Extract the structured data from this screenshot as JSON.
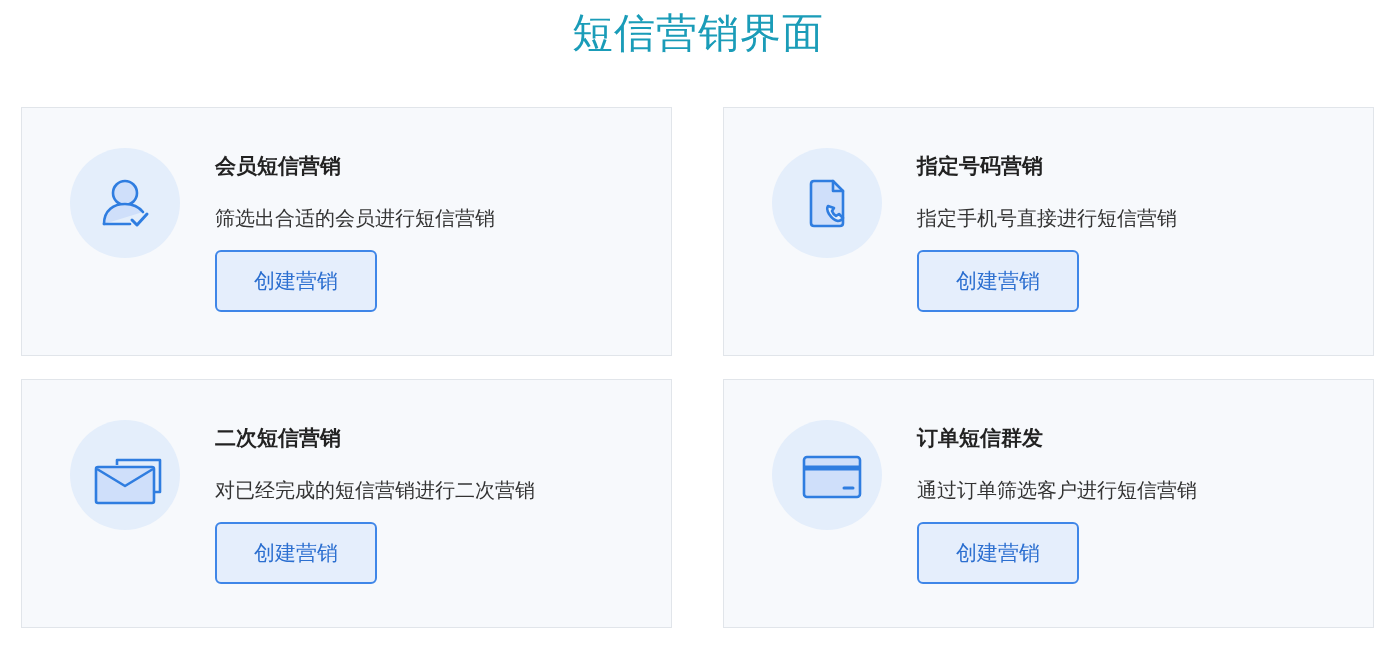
{
  "title": "短信营销界面",
  "cards": [
    {
      "title": "会员短信营销",
      "description": "筛选出合适的会员进行短信营销",
      "button": "创建营销"
    },
    {
      "title": "指定号码营销",
      "description": "指定手机号直接进行短信营销",
      "button": "创建营销"
    },
    {
      "title": "二次短信营销",
      "description": "对已经完成的短信营销进行二次营销",
      "button": "创建营销"
    },
    {
      "title": "订单短信群发",
      "description": "通过订单筛选客户进行短信营销",
      "button": "创建营销"
    }
  ]
}
